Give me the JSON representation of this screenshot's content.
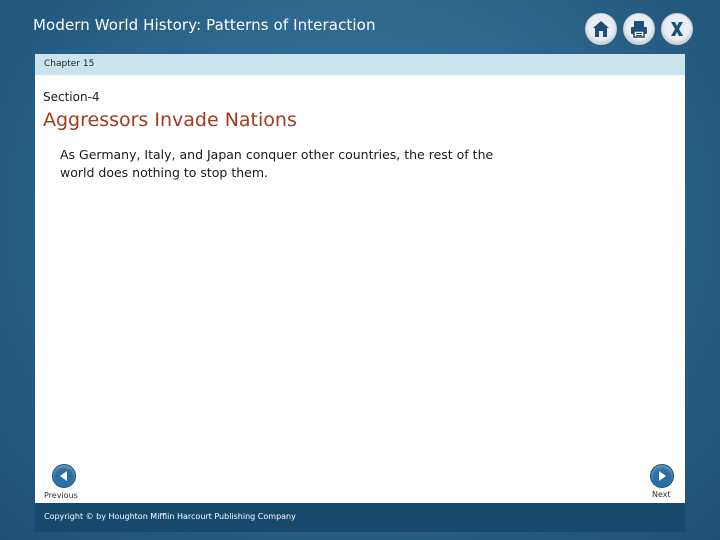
{
  "header": {
    "title": "Modern World History: Patterns of Interaction",
    "buttons": [
      {
        "name": "home-button",
        "icon": "home-icon"
      },
      {
        "name": "print-button",
        "icon": "printer-icon"
      },
      {
        "name": "close-button",
        "icon": "close-icon"
      }
    ]
  },
  "chapter": {
    "label": "Chapter 15"
  },
  "section": {
    "label": "Section-4",
    "title": "Aggressors Invade Nations",
    "body": "As Germany, Italy, and Japan conquer other countries, the rest of the world does nothing to stop them."
  },
  "navigation": {
    "previous_label": "Previous",
    "next_label": "Next",
    "previous_icon": "arrow-left-icon",
    "next_icon": "arrow-right-icon"
  },
  "footer": {
    "copyright": "Copyright © by Houghton Mifflin Harcourt Publishing Company"
  },
  "colors": {
    "background": "#2a6389",
    "chapter_bar": "#c9e3ef",
    "title_accent": "#a23b1e",
    "footer": "#17496c",
    "nav_button": "#2b6ea3"
  }
}
